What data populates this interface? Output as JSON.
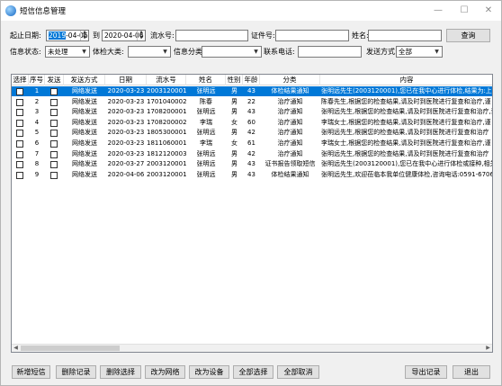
{
  "window": {
    "title": "短信信息管理",
    "minimize": "—",
    "maximize": "☐",
    "close": "✕"
  },
  "filter": {
    "start_label": "起止日期:",
    "start_year": "2019",
    "start_rest": "-04-06",
    "to_label": "到",
    "end_date": "2020-04-06",
    "serial_label": "流水号:",
    "serial_value": "",
    "cert_label": "证件号:",
    "cert_value": "",
    "name_label": "姓名:",
    "name_value": "",
    "query_button": "查询",
    "status_label": "信息状态:",
    "status_value": "未处理",
    "exam_label": "体检大类:",
    "exam_value": "",
    "category_label": "信息分类:",
    "category_value": "",
    "phone_label": "联系电话:",
    "phone_value": "",
    "send_method_label": "发送方式:",
    "send_method_value": "全部"
  },
  "table": {
    "columns": [
      "选择",
      "序号",
      "发送",
      "发送方式",
      "日期",
      "流水号",
      "姓名",
      "性别",
      "年龄",
      "分类",
      "内容"
    ],
    "rows": [
      {
        "seq": "1",
        "method": "网络发送",
        "date": "2020-03-23",
        "serial": "2003120001",
        "name": "张明远",
        "sex": "男",
        "age": "43",
        "cat": "体检结果通知",
        "content": "张明远先生(2003120001),您已在我中心进行体检,结果为:上述"
      },
      {
        "seq": "2",
        "method": "网络发送",
        "date": "2020-03-23",
        "serial": "1701040002",
        "name": "陈春",
        "sex": "男",
        "age": "22",
        "cat": "治疗通知",
        "content": "陈春先生,根据您的检查结果,请及时到医院进行复查和治疗,谨"
      },
      {
        "seq": "3",
        "method": "网络发送",
        "date": "2020-03-23",
        "serial": "1708200001",
        "name": "张明远",
        "sex": "男",
        "age": "43",
        "cat": "治疗通知",
        "content": "张明远先生,根据您的检查结果,请及时到医院进行复查和治疗,谨"
      },
      {
        "seq": "4",
        "method": "网络发送",
        "date": "2020-03-23",
        "serial": "1708200002",
        "name": "李瑞",
        "sex": "女",
        "age": "60",
        "cat": "治疗通知",
        "content": "李瑞女士,根据您的检查结果,请及时到医院进行复查和治疗,谨"
      },
      {
        "seq": "5",
        "method": "网络发送",
        "date": "2020-03-23",
        "serial": "1805300001",
        "name": "张明远",
        "sex": "男",
        "age": "42",
        "cat": "治疗通知",
        "content": "张明远先生,根据您的检查结果,请及时到医院进行复查和治疗"
      },
      {
        "seq": "6",
        "method": "网络发送",
        "date": "2020-03-23",
        "serial": "1811060001",
        "name": "李瑞",
        "sex": "女",
        "age": "61",
        "cat": "治疗通知",
        "content": "李瑞女士,根据您的检查结果,请及时到医院进行复查和治疗,谨"
      },
      {
        "seq": "7",
        "method": "网络发送",
        "date": "2020-03-23",
        "serial": "1812120003",
        "name": "张明远",
        "sex": "男",
        "age": "42",
        "cat": "治疗通知",
        "content": "张明远先生,根据您的检查结果,请及时到医院进行复查和治疗"
      },
      {
        "seq": "8",
        "method": "网络发送",
        "date": "2020-03-27",
        "serial": "2003120001",
        "name": "张明远",
        "sex": "男",
        "age": "43",
        "cat": "证书报告领取短信",
        "content": "张明远先生(2003120001),您已在我中心进行体检或接种,相关证"
      },
      {
        "seq": "9",
        "method": "网络发送",
        "date": "2020-04-06",
        "serial": "2003120001",
        "name": "张明远",
        "sex": "男",
        "age": "43",
        "cat": "体检结果通知",
        "content": "张明远先生,欢迎莅临本我单位健康体检,咨询电话:0591-6706568"
      }
    ]
  },
  "buttons": {
    "add": "新增短信",
    "delete_record": "删除记录",
    "delete_selected": "删除选择",
    "to_network": "改为网络",
    "to_device": "改为设备",
    "select_all": "全部选择",
    "deselect_all": "全部取消",
    "export": "导出记录",
    "exit": "退出"
  },
  "colors": {
    "selection": "#0078d7"
  }
}
